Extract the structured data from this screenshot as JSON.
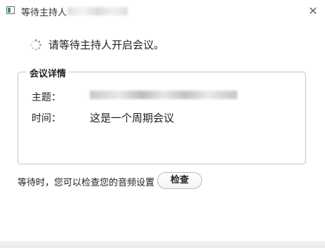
{
  "window": {
    "title": "等待主持人",
    "close_icon": "close-icon"
  },
  "status": {
    "message": "请等待主持人开启会议。",
    "icon": "spinner-icon"
  },
  "details": {
    "legend": "会议详情",
    "topic_label": "主题：",
    "time_label": "时间：",
    "time_value": "这是一个周期会议"
  },
  "footer": {
    "hint": "等待时，您可以检查您的音频设置",
    "check_button": "检查"
  },
  "colors": {
    "accent": "#2e9c63",
    "border": "#c4c4c4"
  }
}
